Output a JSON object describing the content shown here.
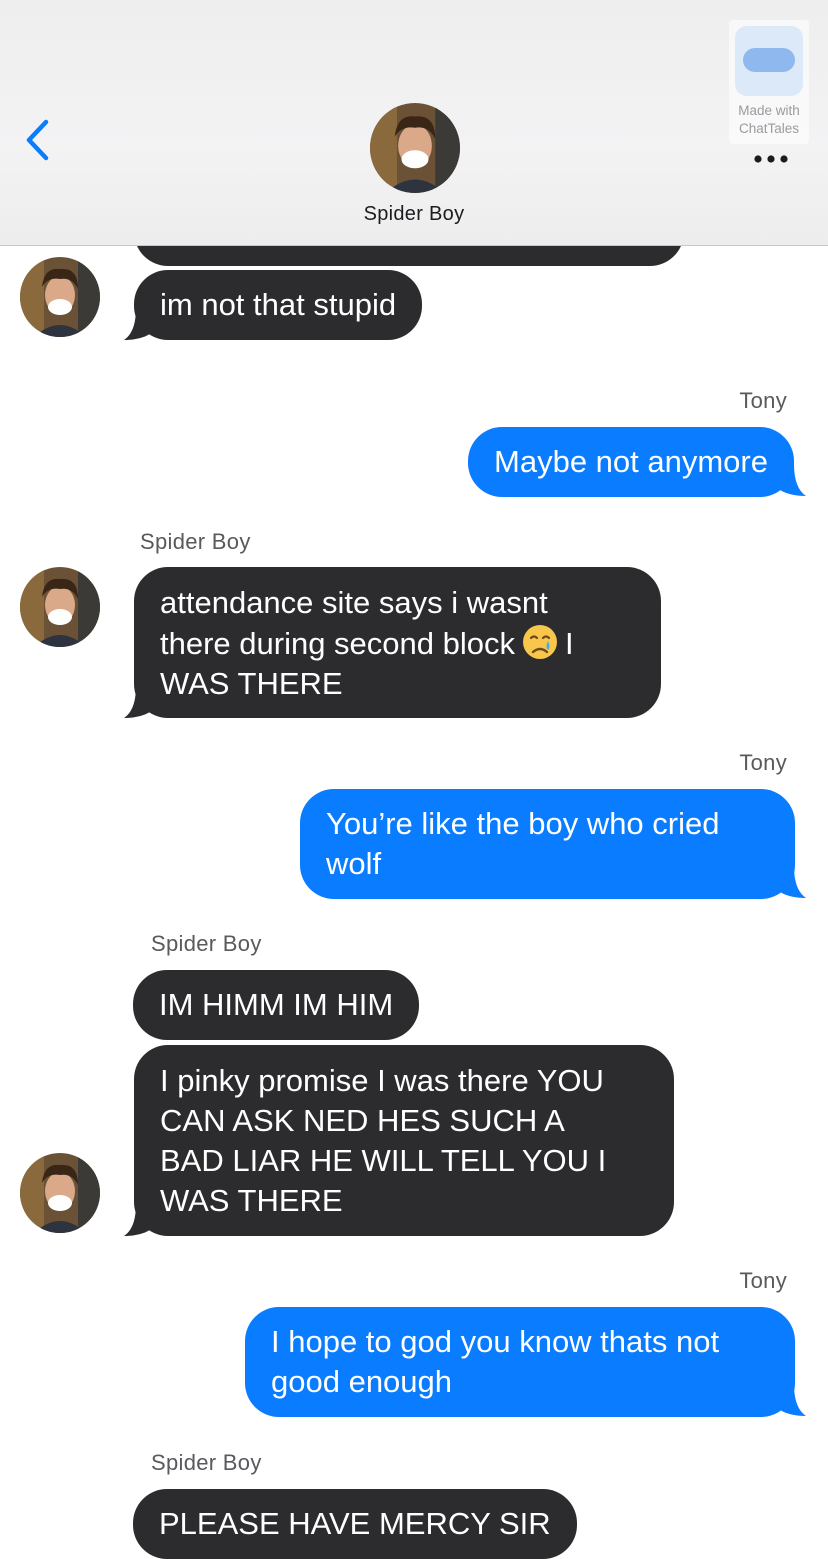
{
  "header": {
    "contact_name": "Spider Boy",
    "badge_text": "Made with ChatTales"
  },
  "colors": {
    "incoming_bubble": "#2c2c2e",
    "outgoing_bubble": "#0a7cff",
    "accent": "#0a7cff"
  },
  "icons": {
    "back": "chevron-left-icon",
    "more": "ellipsis-icon",
    "emoji": "crying-face-icon"
  },
  "messages": [
    {
      "id": "m1",
      "from": "Spider Boy",
      "side": "in",
      "text": "im not that stupid"
    },
    {
      "id": "m2",
      "from": "Tony",
      "side": "out",
      "sender_label": "Tony",
      "text": "Maybe not anymore"
    },
    {
      "id": "m3",
      "from": "Spider Boy",
      "side": "in",
      "sender_label": "Spider Boy",
      "text_line1": "attendance site says i wasnt",
      "text_line2a": "there during second block",
      "text_line2b": "I",
      "text_line3": "WAS THERE"
    },
    {
      "id": "m4",
      "from": "Tony",
      "side": "out",
      "sender_label": "Tony",
      "text": "You’re like the boy who cried\nwolf"
    },
    {
      "id": "m5",
      "from": "Spider Boy",
      "side": "in",
      "sender_label": "Spider Boy",
      "text": "IM HIMM IM HIM"
    },
    {
      "id": "m6",
      "from": "Spider Boy",
      "side": "in",
      "text": "I pinky promise I was there YOU\nCAN ASK NED HES SUCH A\nBAD LIAR HE WILL TELL YOU I\nWAS THERE"
    },
    {
      "id": "m7",
      "from": "Tony",
      "side": "out",
      "sender_label": "Tony",
      "text": "I hope to god you know thats not\ngood enough"
    },
    {
      "id": "m8",
      "from": "Spider Boy",
      "side": "in",
      "sender_label": "Spider Boy",
      "text": "PLEASE HAVE MERCY SIR"
    }
  ]
}
